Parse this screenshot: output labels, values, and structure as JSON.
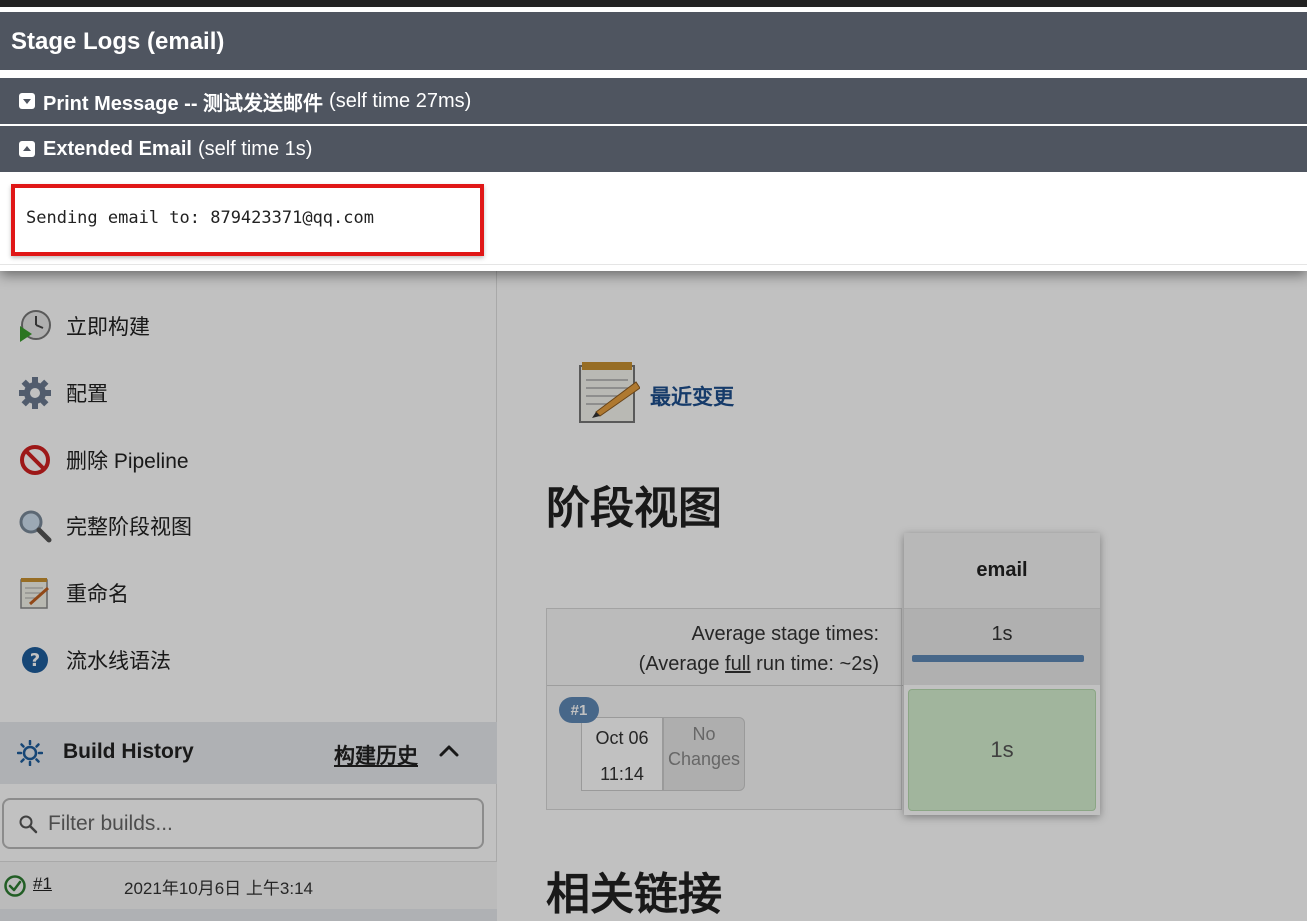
{
  "modal": {
    "title": "Stage Logs (email)",
    "sections": [
      {
        "name": "Print Message -- 测试发送邮件",
        "time": "(self time 27ms)",
        "state": "collapsed"
      },
      {
        "name": "Extended Email",
        "time": "(self time 1s)",
        "state": "expanded"
      }
    ],
    "log_text": "Sending email to: 879423371@qq.com",
    "highlight_color": "#e01717"
  },
  "sidebar": {
    "tasks": [
      {
        "label": "立即构建",
        "icon": "build-now-icon"
      },
      {
        "label": "配置",
        "icon": "gear-icon"
      },
      {
        "label": "删除 Pipeline",
        "icon": "delete-icon"
      },
      {
        "label": "完整阶段视图",
        "icon": "search-icon"
      },
      {
        "label": "重命名",
        "icon": "notepad-icon"
      },
      {
        "label": "流水线语法",
        "icon": "help-icon"
      }
    ],
    "build_history": {
      "title": "Build History",
      "link": "构建历史",
      "filter_placeholder": "Filter builds...",
      "builds": [
        {
          "number": "#1",
          "date": "2021年10月6日 上午3:14",
          "status": "success"
        }
      ]
    }
  },
  "main": {
    "recent_changes": "最近变更",
    "stage_view_heading": "阶段视图",
    "related_links_heading": "相关链接",
    "stage_view": {
      "avg_stage_times_label": "Average stage times:",
      "avg_full_prefix": "(Average ",
      "avg_full_link": "full",
      "avg_full_suffix": " run time: ~2s)",
      "stage_name": "email",
      "stage_avg": "1s",
      "run": {
        "badge": "#1",
        "date": "Oct 06",
        "time": "11:14",
        "changes_line1": "No",
        "changes_line2": "Changes",
        "stage_time": "1s"
      }
    }
  },
  "colors": {
    "modal_header": "#4f5560",
    "stage_success": "#d5f0d0",
    "avg_bar": "#5e88b6",
    "link": "#1e4f8c"
  }
}
